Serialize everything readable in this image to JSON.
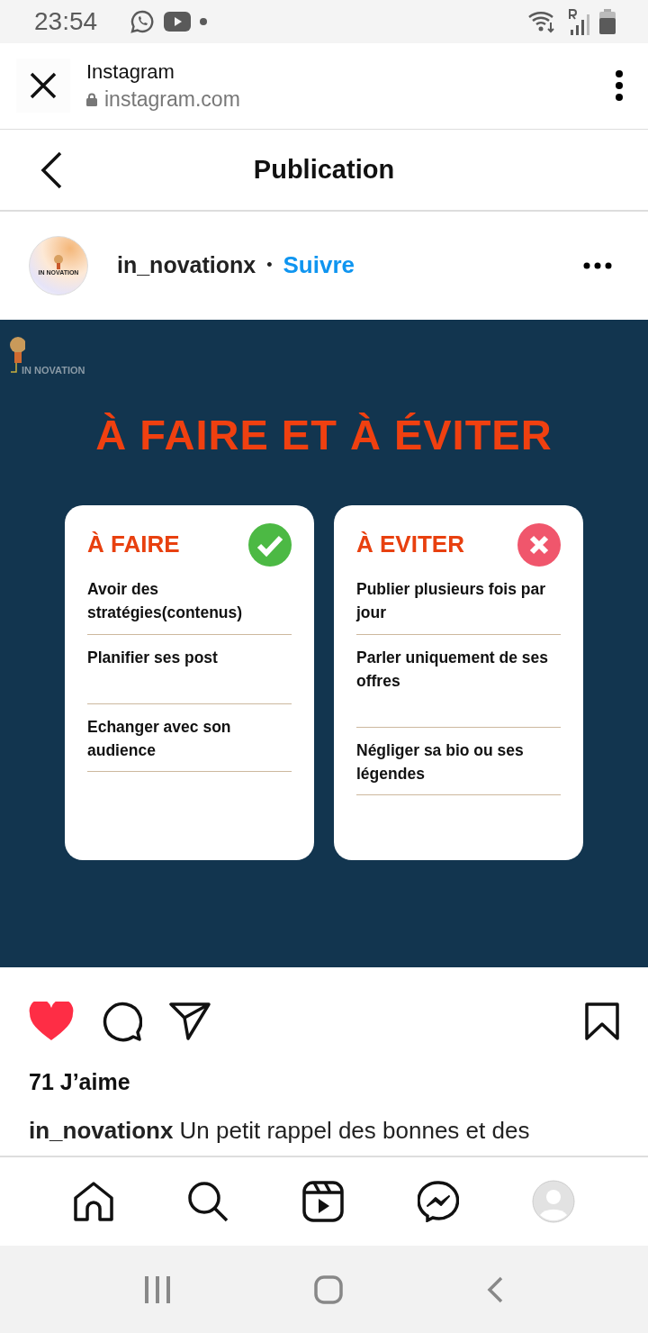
{
  "status_bar": {
    "time": "23:54"
  },
  "browser": {
    "title": "Instagram",
    "url": "instagram.com"
  },
  "page_header": {
    "title": "Publication"
  },
  "post": {
    "author": "in_novationx",
    "separator": "•",
    "follow": "Suivre",
    "avatar_logo": "IN NOVATION",
    "graphic": {
      "logo": "IN NOVATION",
      "title": "À FAIRE ET À ÉVITER",
      "cards": [
        {
          "kind": "do",
          "heading": "À FAIRE",
          "items": [
            "Avoir des stratégies(contenus)",
            "Planifier ses post",
            "Echanger avec son audience"
          ]
        },
        {
          "kind": "avoid",
          "heading": "À EVITER",
          "items": [
            "Publier plusieurs fois par jour",
            "Parler uniquement de ses offres",
            "Négliger sa bio ou ses légendes"
          ]
        }
      ]
    },
    "liked": true,
    "likes": "71 J’aime",
    "caption": {
      "author": "in_novationx",
      "text": "Un petit rappel des bonnes et des"
    }
  }
}
